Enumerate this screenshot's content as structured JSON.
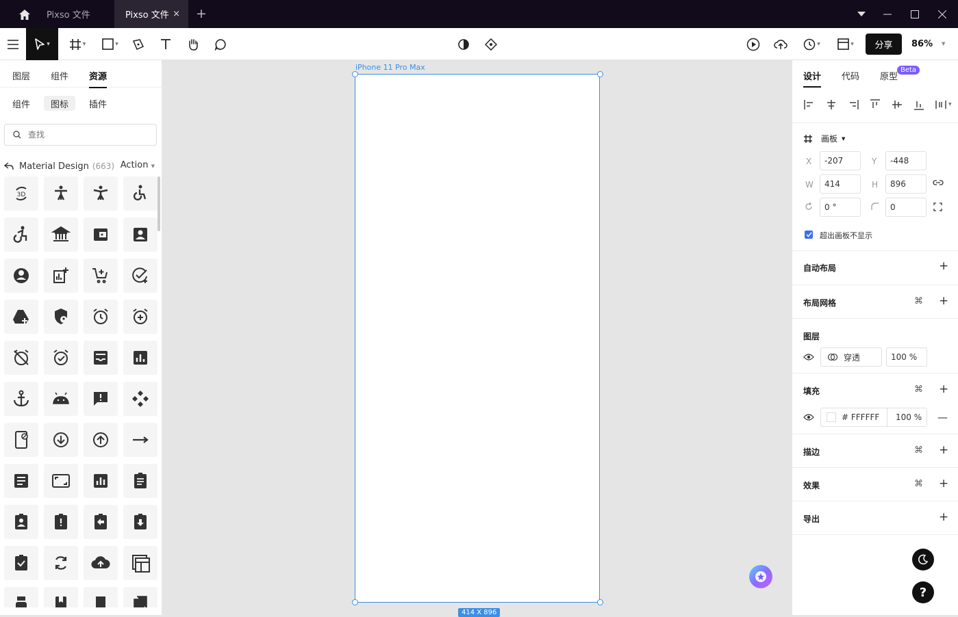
{
  "titlebar": {
    "tabs": [
      {
        "label": "Pixso 文件"
      },
      {
        "label": "Pixso 文件"
      }
    ],
    "close_label": "×",
    "add_label": "+"
  },
  "toolbar": {
    "share_label": "分享",
    "zoom": "86%"
  },
  "left_panel": {
    "tabs": [
      "图层",
      "组件",
      "资源"
    ],
    "active_tab": "资源",
    "subtabs": [
      "组件",
      "图标",
      "插件"
    ],
    "active_subtab": "图标",
    "search_placeholder": "查找",
    "library_name": "Material Design",
    "library_count": "(663)",
    "category": "Action",
    "icons": [
      "3d-rotation-icon",
      "accessibility-icon",
      "accessibility-new-icon",
      "accessible-icon",
      "accessible-forward-icon",
      "account-balance-icon",
      "account-balance-wallet-icon",
      "account-box-icon",
      "account-circle-icon",
      "add-chart-icon",
      "add-shopping-cart-icon",
      "add-task-icon",
      "add-to-drive-icon",
      "admin-panel-settings-icon",
      "alarm-icon",
      "alarm-add-icon",
      "alarm-off-icon",
      "alarm-on-icon",
      "all-inbox-icon",
      "analytics-icon",
      "anchor-icon",
      "android-icon",
      "announcement-icon",
      "api-icon",
      "app-blocking-icon",
      "arrow-circle-down-icon",
      "arrow-circle-up-icon",
      "arrow-right-alt-icon",
      "article-icon",
      "aspect-ratio-icon",
      "assessment-icon",
      "assignment-icon",
      "assignment-ind-icon",
      "assignment-late-icon",
      "assignment-return-icon",
      "assignment-returned-icon",
      "assignment-turned-in-icon",
      "autorenew-icon",
      "backup-icon",
      "backup-table-icon",
      "batch-prediction-icon",
      "book-icon",
      "bookmark-icon",
      "bookmarks-icon"
    ]
  },
  "canvas": {
    "frame_label": "iPhone 11 Pro Max",
    "frame_dims": "414 X 896"
  },
  "right_panel": {
    "tabs": [
      "设计",
      "代码",
      "原型"
    ],
    "active_tab": "设计",
    "beta": "Beta",
    "frame_type": "画板",
    "x_label": "X",
    "x": "-207",
    "y_label": "Y",
    "y": "-448",
    "w_label": "W",
    "w": "414",
    "h_label": "H",
    "h": "896",
    "rotation": "0 °",
    "radius": "0",
    "clip_label": "超出画板不显示",
    "auto_layout": "自动布局",
    "layout_grid": "布局网格",
    "layer": "图层",
    "blend_mode": "穿透",
    "layer_opacity": "100 %",
    "fill": "填充",
    "fill_hex": "# FFFFFF",
    "fill_opacity": "100 %",
    "stroke": "描边",
    "effect": "效果",
    "export": "导出",
    "help_label": "?"
  },
  "colors": {
    "titlebar_bg": "#120b1c",
    "accent": "#3a8fe8",
    "checkbox": "#3a6ff0",
    "beta_badge": "#7b5cff"
  }
}
